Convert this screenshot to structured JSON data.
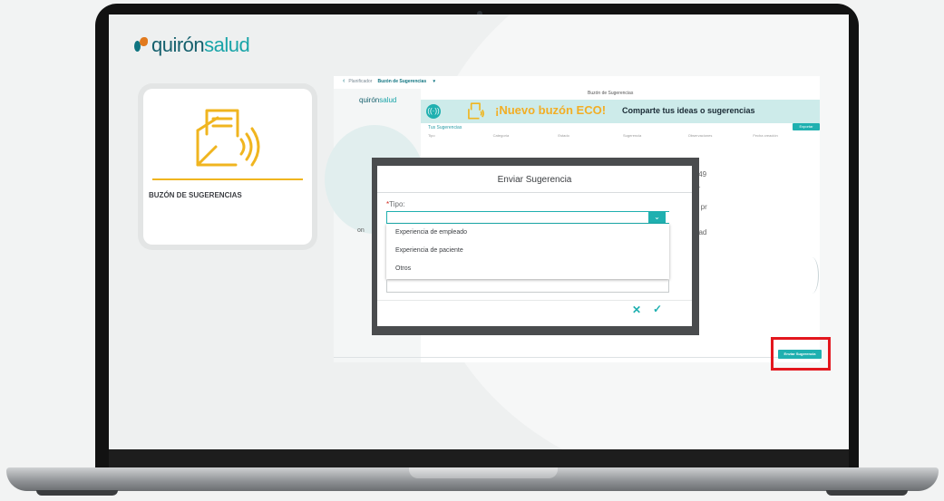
{
  "brand": {
    "part1": "quirón",
    "part2": "salud"
  },
  "tile": {
    "label": "BUZÓN DE SUGERENCIAS"
  },
  "app": {
    "breadcrumb_back": "Planificador",
    "breadcrumb_current": "Buzón de Sugerencias",
    "mini_logo_1": "quirón",
    "mini_logo_2": "salud",
    "table_title": "Buzón de Sugerencias",
    "banner_big": "¡Nuevo buzón ECO!",
    "banner_sub": "Comparte tus ideas o sugerencias",
    "my_suggestions": "Tus Sugerencias",
    "export_label": "Exportar",
    "columns": [
      "Tipo",
      "Categoría",
      "Estado",
      "Sugerencia",
      "Observaciones",
      "Fecha creación"
    ],
    "peek_texts": [
      "ej49",
      "f...",
      "a pr",
      "dad",
      "p"
    ],
    "side_text": "on"
  },
  "send_button": "Enviar Sugerencia",
  "dialog": {
    "title": "Enviar Sugerencia",
    "field_label": "Tipo:",
    "required_mark": "*",
    "options": [
      "Experiencia de empleado",
      "Experiencia de paciente",
      "Otros"
    ],
    "cancel_icon": "close-icon",
    "confirm_icon": "check-icon"
  },
  "colors": {
    "accent": "#1fb0b0",
    "brand_dark": "#15606d",
    "highlight": "#e3171e",
    "yellow": "#f0b51f"
  }
}
